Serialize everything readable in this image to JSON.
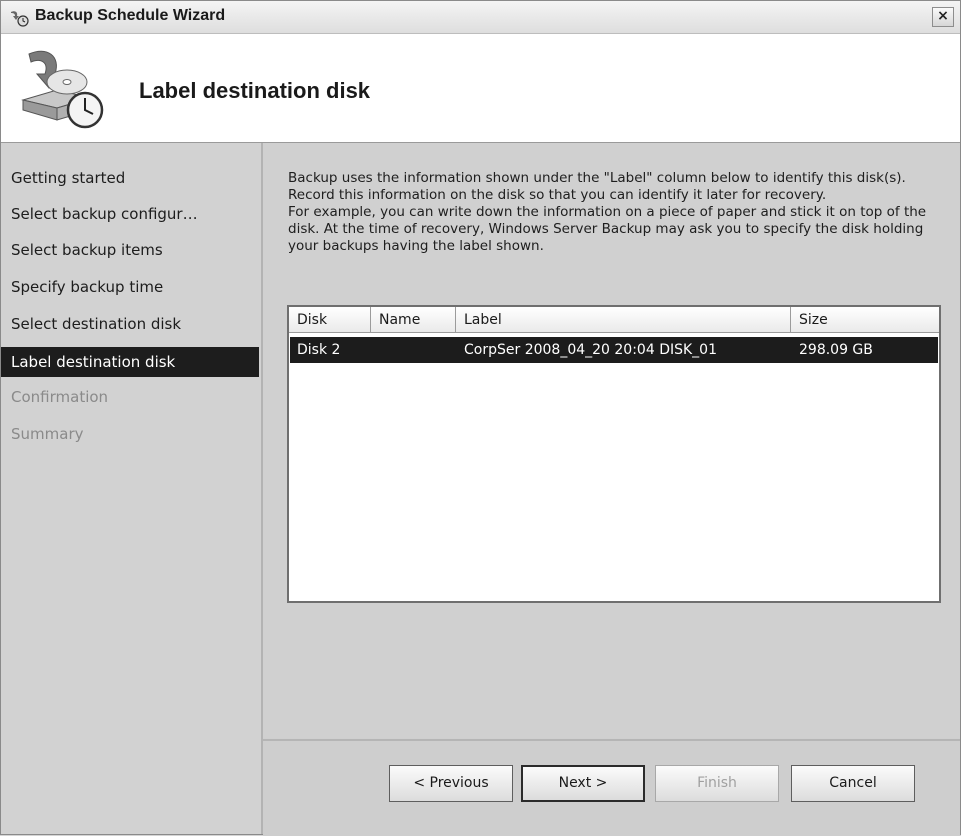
{
  "window": {
    "title": "Backup Schedule Wizard",
    "close_glyph": "×"
  },
  "header": {
    "title": "Label destination disk",
    "icon": "backup-wizard-icon"
  },
  "nav": {
    "items": [
      {
        "label": "Getting started",
        "state": "normal"
      },
      {
        "label": "Select backup configur…",
        "state": "normal"
      },
      {
        "label": "Select backup items",
        "state": "normal"
      },
      {
        "label": "Specify backup time",
        "state": "normal"
      },
      {
        "label": "Select destination disk",
        "state": "normal"
      },
      {
        "label": "Label destination disk",
        "state": "active"
      },
      {
        "label": "Confirmation",
        "state": "disabled"
      },
      {
        "label": "Summary",
        "state": "disabled"
      }
    ]
  },
  "main": {
    "paragraph1": "Backup uses the information shown under the \"Label\" column below to identify this disk(s). Record this information on the disk so that you can identify it later for recovery.",
    "paragraph2": "For example, you can write down the information on a piece of paper and stick it on top of the disk. At the time of recovery, Windows Server Backup may ask you to specify the disk holding your backups having the label shown."
  },
  "table": {
    "columns": [
      "Disk",
      "Name",
      "Label",
      "Size"
    ],
    "rows": [
      {
        "disk": "Disk 2",
        "name": "",
        "label": "CorpSer 2008_04_20 20:04 DISK_01",
        "size": "298.09 GB",
        "selected": true
      }
    ]
  },
  "buttons": {
    "previous": "< Previous",
    "next": "Next >",
    "finish": "Finish",
    "cancel": "Cancel"
  }
}
